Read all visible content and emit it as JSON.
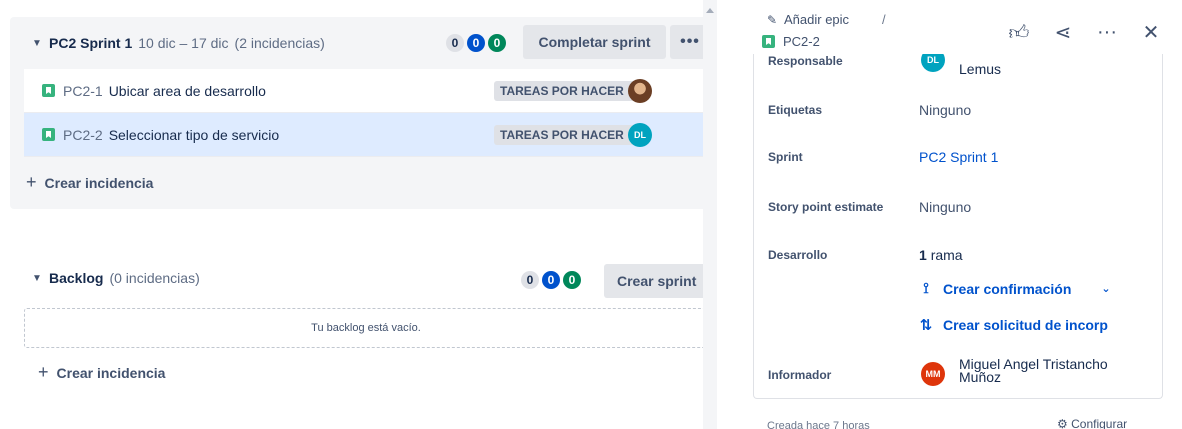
{
  "sprint": {
    "name": "PC2 Sprint 1",
    "dates": "10 dic – 17 dic",
    "count": "(2 incidencias)",
    "badges": [
      "0",
      "0",
      "0"
    ],
    "complete_label": "Completar sprint",
    "more_label": "•••",
    "issues": [
      {
        "key": "PC2-1",
        "summary": "Ubicar area de desarrollo",
        "status": "TAREAS POR HACER ⌄",
        "avatar": ""
      },
      {
        "key": "PC2-2",
        "summary": "Seleccionar tipo de servicio",
        "status": "TAREAS POR HACER ⌄",
        "avatar": "DL"
      }
    ],
    "create_label": "Crear incidencia"
  },
  "backlog": {
    "name": "Backlog",
    "count": "(0 incidencias)",
    "badges": [
      "0",
      "0",
      "0"
    ],
    "create_sprint_label": "Crear sprint",
    "empty_text": "Tu backlog está vacío.",
    "create_label": "Crear incidencia"
  },
  "detail": {
    "add_epic": "Añadir epic",
    "separator": "/",
    "issue_key": "PC2-2",
    "assignee_label": "Responsable",
    "assignee_avatar": "DL",
    "assignee_name": "Lemus",
    "labels_label": "Etiquetas",
    "labels_value": "Ninguno",
    "sprint_label": "Sprint",
    "sprint_value": "PC2 Sprint 1",
    "estimate_label": "Story point estimate",
    "estimate_value": "Ninguno",
    "dev_label": "Desarrollo",
    "branch_count": "1",
    "branch_text": "rama",
    "commit_label": "Crear confirmación",
    "pr_label": "Crear solicitud de incorp",
    "reporter_label": "Informador",
    "reporter_avatar": "MM",
    "reporter_name": "Miguel Angel Tristancho Muñoz",
    "created_text": "Creada hace 7 horas",
    "config_text": "Configurar"
  },
  "icons": {
    "like": "like-icon",
    "share": "share-icon",
    "more": "more-icon",
    "close": "close-icon"
  },
  "colors": {
    "selected_row": "#deebff",
    "link": "#0052cc",
    "done_badge": "#00875a",
    "progress_badge": "#0052cc"
  }
}
